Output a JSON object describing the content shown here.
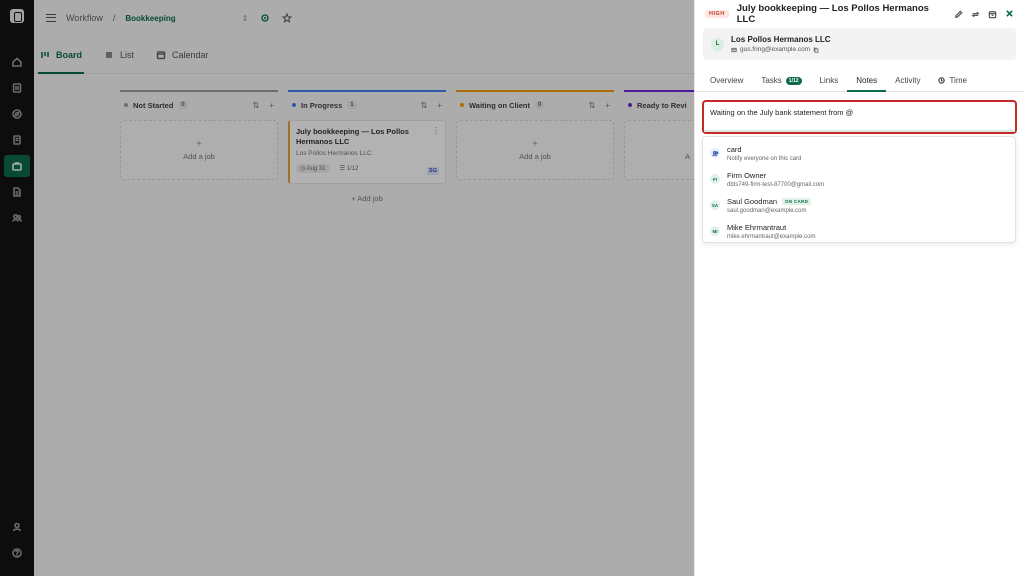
{
  "breadcrumb": {
    "root": "Workflow",
    "separator": "/",
    "current": "Bookkeeping"
  },
  "view_tabs": [
    {
      "label": "Board",
      "active": true
    },
    {
      "label": "List",
      "active": false
    },
    {
      "label": "Calendar",
      "active": false
    }
  ],
  "columns": [
    {
      "title": "Not Started",
      "count": "0",
      "color": "#9e9e9e",
      "add_label": "Add a job"
    },
    {
      "title": "In Progress",
      "count": "1",
      "color": "#3b82f6",
      "add_job_label": "+ Add job"
    },
    {
      "title": "Waiting on Client",
      "count": "0",
      "color": "#f59e0b",
      "add_label": "Add a job"
    },
    {
      "title": "Ready to Revi",
      "count": "",
      "color": "#6d28d9",
      "add_label": "A"
    }
  ],
  "job_card": {
    "title": "July bookkeeping — Los Pollos Hermanos LLC",
    "client": "Los Pollos Hermanos LLC",
    "due": "Aug 31",
    "tasks": "1/12",
    "assignee": "SG"
  },
  "panel": {
    "priority": "HIGH",
    "title": "July bookkeeping — Los Pollos Hermanos LLC",
    "client": {
      "initial": "L",
      "name": "Los Pollos Hermanos LLC",
      "email": "gus.fring@example.com"
    },
    "tabs": [
      {
        "label": "Overview"
      },
      {
        "label": "Tasks",
        "badge": "1/12"
      },
      {
        "label": "Links"
      },
      {
        "label": "Notes"
      },
      {
        "label": "Activity"
      },
      {
        "label": "Time"
      }
    ],
    "note_value": "Waiting on the July bank statement from @"
  },
  "mentions": [
    {
      "initials": "",
      "name": "card",
      "sub": "Notify everyone on this card",
      "tag": ""
    },
    {
      "initials": "FI",
      "name": "Firm Owner",
      "sub": "dbts749-firm-test-87700@gmail.com",
      "tag": ""
    },
    {
      "initials": "SA",
      "name": "Saul Goodman",
      "sub": "saul.goodman@example.com",
      "tag": "ON CARD"
    },
    {
      "initials": "MI",
      "name": "Mike Ehrmantraut",
      "sub": "mike.ehrmantraut@example.com",
      "tag": ""
    }
  ]
}
